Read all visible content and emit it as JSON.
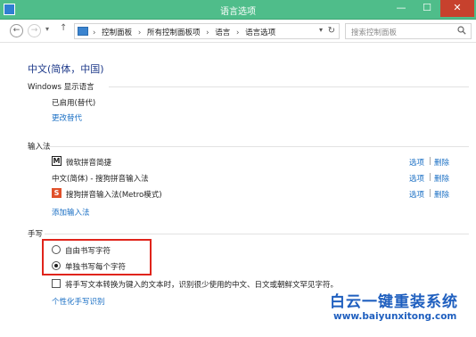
{
  "window": {
    "title": "语言选项",
    "minimize": "—",
    "maximize": "☐",
    "close": "✕"
  },
  "nav": {
    "back": "←",
    "forward": "→",
    "recent": "▾",
    "up": "↑",
    "breadcrumb": [
      "控制面板",
      "所有控制面板项",
      "语言",
      "语言选项"
    ],
    "separator": "›",
    "dropdown": "▾",
    "refresh": "↻",
    "search_placeholder": "搜索控制面板"
  },
  "language": {
    "title": "中文(简体，中国)"
  },
  "display_language": {
    "header": "Windows 显示语言",
    "status": "已启用(替代)",
    "change_link": "更改替代"
  },
  "input_method": {
    "header": "输入法",
    "items": [
      {
        "icon": "M",
        "name": "微软拼音简捷",
        "options": "选项",
        "delete": "删除"
      },
      {
        "icon": "",
        "name": "中文(简体) - 搜狗拼音输入法",
        "options": "选项",
        "delete": "删除"
      },
      {
        "icon": "S",
        "name": "搜狗拼音输入法(Metro模式)",
        "options": "选项",
        "delete": "删除"
      }
    ],
    "pipe": "|",
    "add_link": "添加输入法"
  },
  "handwriting": {
    "header": "手写",
    "options": [
      {
        "label": "自由书写字符",
        "checked": false
      },
      {
        "label": "单独书写每个字符",
        "checked": true
      }
    ],
    "checkbox_label": "将手写文本转换为键入的文本时，识别很少使用的中文、日文或朝鲜文罕见字符。",
    "checkbox_checked": false,
    "personalize_link": "个性化手写识别"
  },
  "watermark": {
    "title": "白云一键重装系统",
    "url": "www.baiyunxitong.com"
  },
  "colors": {
    "titlebar": "#4fbd8a",
    "close_button": "#c7412d",
    "link": "#1a6fc4",
    "highlight_box": "#e0241b",
    "watermark": "#1f5fbf"
  }
}
